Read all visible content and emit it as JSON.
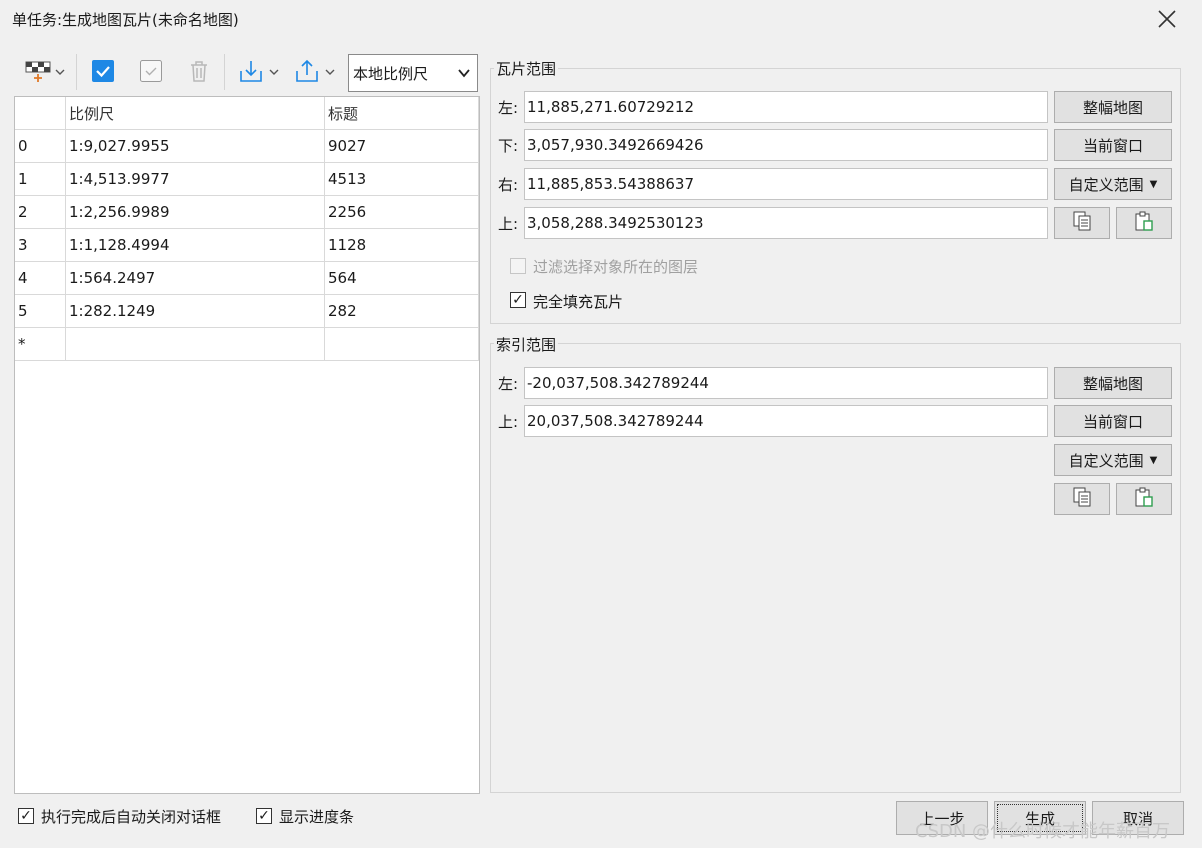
{
  "window": {
    "title": "单任务:生成地图瓦片(未命名地图)"
  },
  "toolbar": {
    "icons": [
      "grid-add-icon",
      "check-all-icon",
      "uncheck-icon",
      "trash-icon",
      "import-icon",
      "export-icon"
    ],
    "scale_type": "本地比例尺"
  },
  "table": {
    "columns": [
      "",
      "比例尺",
      "标题"
    ],
    "rows": [
      {
        "index": "0",
        "scale": "1:9,027.9955",
        "title": "9027"
      },
      {
        "index": "1",
        "scale": "1:4,513.9977",
        "title": "4513"
      },
      {
        "index": "2",
        "scale": "1:2,256.9989",
        "title": "2256"
      },
      {
        "index": "3",
        "scale": "1:1,128.4994",
        "title": "1128"
      },
      {
        "index": "4",
        "scale": "1:564.2497",
        "title": "564"
      },
      {
        "index": "5",
        "scale": "1:282.1249",
        "title": "282"
      }
    ],
    "new_row_marker": "*"
  },
  "tile_range": {
    "title": "瓦片范围",
    "left_label": "左:",
    "left_value": "11,885,271.60729212",
    "bottom_label": "下:",
    "bottom_value": "3,057,930.3492669426",
    "right_label": "右:",
    "right_value": "11,885,853.54388637",
    "top_label": "上:",
    "top_value": "3,058,288.3492530123",
    "full_map_button": "整幅地图",
    "current_window_button": "当前窗口",
    "custom_range_button": "自定义范围",
    "filter_label": "过滤选择对象所在的图层",
    "filter_checked": false,
    "fill_label": "完全填充瓦片",
    "fill_checked": true
  },
  "index_range": {
    "title": "索引范围",
    "left_label": "左:",
    "left_value": "-20,037,508.342789244",
    "top_label": "上:",
    "top_value": "20,037,508.342789244",
    "full_map_button": "整幅地图",
    "current_window_button": "当前窗口",
    "custom_range_button": "自定义范围"
  },
  "footer": {
    "auto_close_label": "执行完成后自动关闭对话框",
    "auto_close_checked": true,
    "progress_label": "显示进度条",
    "progress_checked": true,
    "prev_button": "上一步",
    "generate_button": "生成",
    "cancel_button": "取消"
  },
  "watermark": "CSDN @什么时候才能年薪百万",
  "colors": {
    "accent": "#1e88e5",
    "window_bg": "#f0f0f0",
    "button_bg": "#e1e1e1"
  }
}
